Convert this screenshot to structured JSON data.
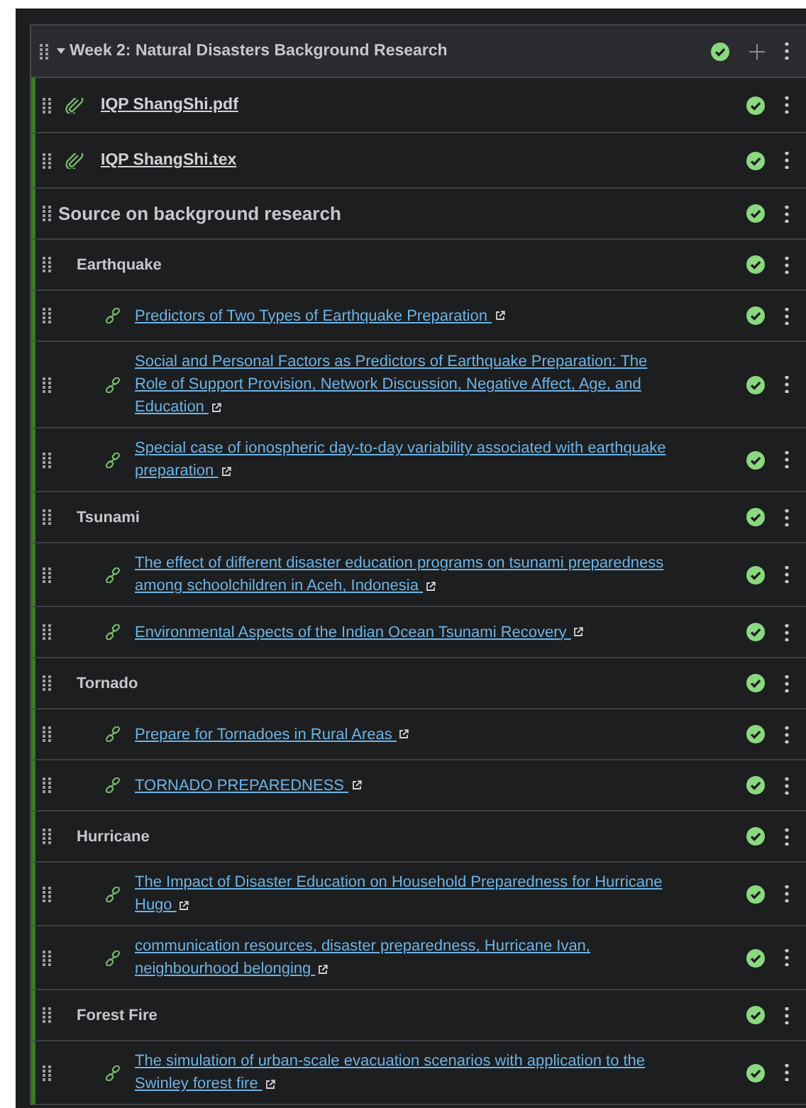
{
  "module": {
    "title": "Week 2: Natural Disasters Background Research",
    "expanded": true,
    "published": true,
    "items": [
      {
        "kind": "file",
        "title": "IQP ShangShi.pdf",
        "published": true
      },
      {
        "kind": "file",
        "title": "IQP ShangShi.tex",
        "published": true
      },
      {
        "kind": "heading",
        "title": "Source on background research",
        "published": true,
        "children": [
          {
            "kind": "heading",
            "title": "Earthquake",
            "published": true,
            "children": [
              {
                "kind": "link",
                "title": "Predictors of Two Types of Earthquake Preparation ",
                "published": true
              },
              {
                "kind": "link",
                "title": "Social and Personal Factors as Predictors of Earthquake Preparation: The Role of Support Provision, Network Discussion, Negative Affect, Age, and Education ",
                "published": true
              },
              {
                "kind": "link",
                "title": "Special case of ionospheric day-to-day variability associated with earthquake preparation ",
                "published": true
              }
            ]
          },
          {
            "kind": "heading",
            "title": "Tsunami",
            "published": true,
            "children": [
              {
                "kind": "link",
                "title": "The effect of different disaster education programs on tsunami preparedness among schoolchildren in Aceh, Indonesia ",
                "published": true
              },
              {
                "kind": "link",
                "title": "Environmental Aspects of the Indian Ocean Tsunami Recovery ",
                "published": true
              }
            ]
          },
          {
            "kind": "heading",
            "title": "Tornado",
            "published": true,
            "children": [
              {
                "kind": "link",
                "title": "Prepare for Tornadoes in Rural Areas ",
                "published": true
              },
              {
                "kind": "link",
                "title": "TORNADO PREPAREDNESS ",
                "published": true
              }
            ]
          },
          {
            "kind": "heading",
            "title": "Hurricane",
            "published": true,
            "children": [
              {
                "kind": "link",
                "title": "The Impact of Disaster Education on Household Preparedness for Hurricane Hugo ",
                "published": true
              },
              {
                "kind": "link",
                "title": "communication resources, disaster preparedness, Hurricane Ivan, neighbourhood belonging ",
                "published": true
              }
            ]
          },
          {
            "kind": "heading",
            "title": "Forest Fire",
            "published": true,
            "children": [
              {
                "kind": "link",
                "title": "The simulation of urban-scale evacuation scenarios with application to the Swinley forest fire ",
                "published": true
              }
            ]
          }
        ]
      }
    ]
  }
}
